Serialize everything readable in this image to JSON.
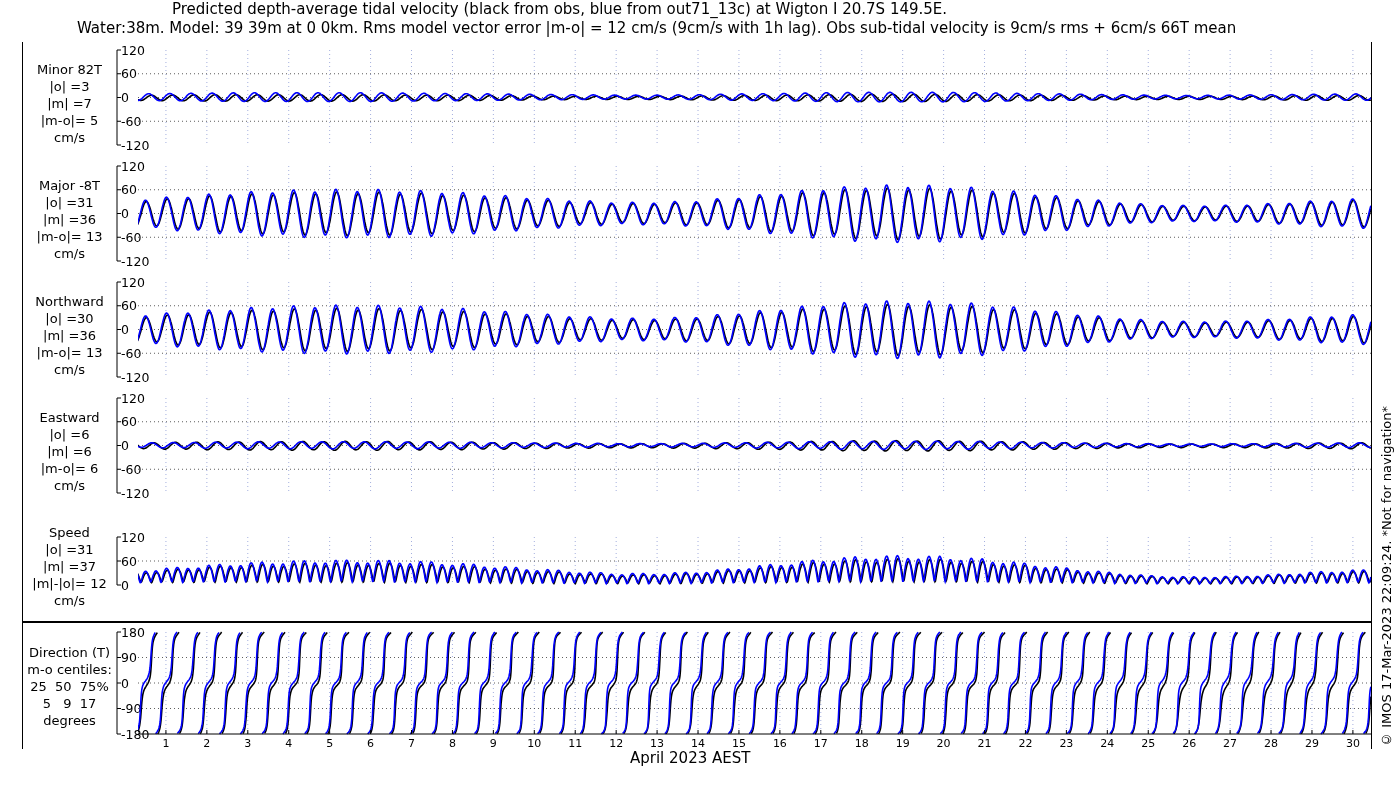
{
  "title_lines": [
    "Predicted depth-average tidal velocity (black from obs, blue from out71_13c) at Wigton I 20.7S 149.5E.",
    "Water:38m. Model: 39 39m at 0 0km. Rms model vector error |m-o| = 12 cm/s (9cm/s with 1h lag). Obs sub-tidal velocity is 9cm/s rms + 6cm/s 66T mean"
  ],
  "panels": [
    {
      "kind": "minor",
      "label_lines": [
        "Minor 82T",
        "|o| =3",
        "|m| =7",
        "|m-o|= 5",
        "cm/s"
      ],
      "yticks": [
        "120",
        "60",
        "0",
        "-60",
        "-120"
      ]
    },
    {
      "kind": "major",
      "label_lines": [
        "Major -8T",
        "|o| =31",
        "|m| =36",
        "|m-o|= 13",
        "cm/s"
      ],
      "yticks": [
        "120",
        "60",
        "0",
        "-60",
        "-120"
      ]
    },
    {
      "kind": "northward",
      "label_lines": [
        "Northward",
        "|o| =30",
        "|m| =36",
        "|m-o|= 13",
        "cm/s"
      ],
      "yticks": [
        "120",
        "60",
        "0",
        "-60",
        "-120"
      ]
    },
    {
      "kind": "eastward",
      "label_lines": [
        "Eastward",
        "|o| =6",
        "|m| =6",
        "|m-o|= 6",
        "cm/s"
      ],
      "yticks": [
        "120",
        "60",
        "0",
        "-60",
        "-120"
      ]
    },
    {
      "kind": "speed",
      "label_lines": [
        "Speed",
        "|o| =31",
        "|m| =37",
        "|m|-|o|= 12",
        "cm/s"
      ],
      "yticks": [
        "120",
        "60",
        "0"
      ]
    },
    {
      "kind": "direction",
      "label_lines": [
        "Direction (T)",
        "m-o centiles:",
        "25  50  75%",
        "5   9  17",
        "degrees"
      ],
      "yticks": [
        "180",
        "90",
        "0",
        "-90",
        "-180"
      ]
    }
  ],
  "x_axis": {
    "ticks": [
      "1",
      "2",
      "3",
      "4",
      "5",
      "6",
      "7",
      "8",
      "9",
      "10",
      "11",
      "12",
      "13",
      "14",
      "15",
      "16",
      "17",
      "18",
      "19",
      "20",
      "21",
      "22",
      "23",
      "24",
      "25",
      "26",
      "27",
      "28",
      "29",
      "30"
    ],
    "title": "April 2023 AEST"
  },
  "note": "© IMOS 17-Mar-2023 22:09:24. *Not for navigation*"
}
